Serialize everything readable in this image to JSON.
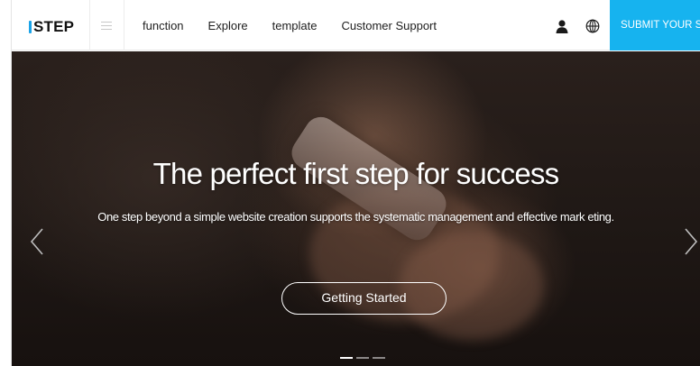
{
  "header": {
    "logo_mark": "1",
    "logo_text": "STEP",
    "menu_icon": "hamburger-icon",
    "nav": [
      {
        "label": "function"
      },
      {
        "label": "Explore"
      },
      {
        "label": "template"
      },
      {
        "label": "Customer Support"
      }
    ],
    "user_icon": "user-icon",
    "language_icon": "globe-icon",
    "submit_label": "SUBMIT YOUR SITE",
    "accent_color": "#16b3ef"
  },
  "hero": {
    "title": "The perfect first step for success",
    "subtitle": "One step beyond a simple website creation supports the systematic management and effective mark eting.",
    "cta_label": "Getting Started",
    "prev_icon": "chevron-left-icon",
    "next_icon": "chevron-right-icon",
    "slides_total": 3,
    "active_slide": 1
  }
}
